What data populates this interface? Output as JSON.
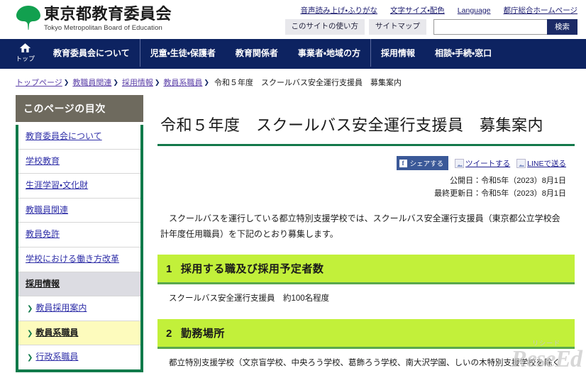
{
  "site": {
    "logo_jp": "東京都教育委員会",
    "logo_en": "Tokyo Metropolitan Board of Education",
    "logo_icon": "green-leaf-logo-icon"
  },
  "utility": {
    "links": [
      "音声読み上げ・ふりがな",
      "文字サイズ・配色",
      "Language",
      "都庁総合ホームページ"
    ],
    "buttons": [
      "このサイトの使い方",
      "サイトマップ"
    ],
    "search": {
      "value": "",
      "placeholder": "",
      "button_label": "検索"
    }
  },
  "gnav": {
    "home_label": "トップ",
    "home_icon": "home-icon",
    "group1": [
      "教育委員会について"
    ],
    "group2": [
      "児童・生徒・保護者",
      "教育関係者",
      "事業者・地域の方"
    ],
    "group3": [
      "採用情報",
      "相談・手続・窓口"
    ]
  },
  "breadcrumb": {
    "links": [
      "トップページ",
      "教職員関連",
      "採用情報",
      "教員系職員"
    ],
    "separator": "❯",
    "current": "令和５年度　スクールバス安全運行支援員　募集案内"
  },
  "sidebar": {
    "heading": "このページの目次",
    "items": [
      {
        "label": "教育委員会について",
        "type": "link"
      },
      {
        "label": "学校教育",
        "type": "link"
      },
      {
        "label": "生涯学習・文化財",
        "type": "link"
      },
      {
        "label": "教職員関連",
        "type": "link"
      },
      {
        "label": "教員免許",
        "type": "link"
      },
      {
        "label": "学校における働き方改革",
        "type": "link"
      },
      {
        "label": "採用情報",
        "type": "section"
      },
      {
        "label": "教員採用案内",
        "type": "sub"
      },
      {
        "label": "教員系職員",
        "type": "sub-current"
      },
      {
        "label": "行政系職員",
        "type": "sub"
      }
    ],
    "chevron": "❯"
  },
  "main": {
    "title": "令和５年度　スクールバス安全運行支援員　募集案内",
    "share": {
      "facebook_label": "シェアする",
      "facebook_glyph": "f",
      "twitter_label": "ツイートする",
      "line_label": "LINEで送る"
    },
    "dates": {
      "published": "公開日：令和5年（2023）8月1日",
      "updated": "最終更新日：令和5年（2023）8月1日"
    },
    "lead": "スクールバスを運行している都立特別支援学校では、スクールバス安全運行支援員（東京都公立学校会計年度任用職員）を下記のとおり募集します。",
    "sections": [
      {
        "num": "1",
        "heading": "採用する職及び採用予定者数",
        "body": "スクールバス安全運行支援員　約100名程度"
      },
      {
        "num": "2",
        "heading": "勤務場所",
        "body": "都立特別支援学校（文京盲学校、中央ろう学校、葛飾ろう学校、南大沢学園、しいの木特別支援学校を除く"
      }
    ]
  },
  "watermark": {
    "small": "リシード",
    "big": "ReseEd"
  },
  "colors": {
    "nav_blue": "#0d2361",
    "brand_green": "#0f7a4a",
    "section_green": "#c2f03a",
    "toc_head_gray": "#6e6a5e",
    "current_yellow": "#fdfbbd"
  }
}
